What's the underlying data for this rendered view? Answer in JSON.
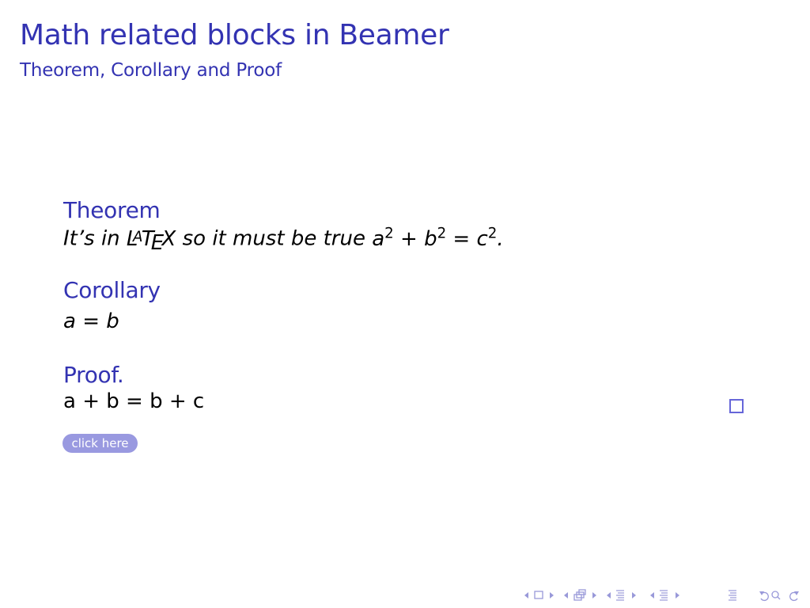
{
  "frame": {
    "title": "Math related blocks in Beamer",
    "subtitle": "Theorem, Corollary and Proof"
  },
  "theorem": {
    "title": "Theorem",
    "body_prefix": "It’s in ",
    "latex_l": "L",
    "latex_a": "A",
    "latex_t": "T",
    "latex_e": "E",
    "latex_x": "X",
    "body_middle": " so it must be true ",
    "eq_a": "a",
    "eq_exp1": "2",
    "eq_plus": " + ",
    "eq_b": "b",
    "eq_exp2": "2",
    "eq_equals": " = ",
    "eq_c": "c",
    "eq_exp3": "2",
    "eq_end": "."
  },
  "corollary": {
    "title": "Corollary",
    "body": "a = b"
  },
  "proof": {
    "title": "Proof.",
    "body": "a + b = b + c",
    "qed_symbol": "qed-square"
  },
  "button": {
    "label": "click here"
  },
  "navigation": {
    "icons": [
      "arrow-left",
      "frame",
      "arrow-right",
      "arrow-left",
      "subsection",
      "arrow-right",
      "arrow-left",
      "section",
      "arrow-right",
      "arrow-left",
      "document",
      "arrow-right",
      "align",
      "back",
      "search",
      "forward"
    ],
    "color": "#9999d9"
  },
  "colors": {
    "structure": "#3333b2",
    "button_bg": "#9999e0"
  }
}
